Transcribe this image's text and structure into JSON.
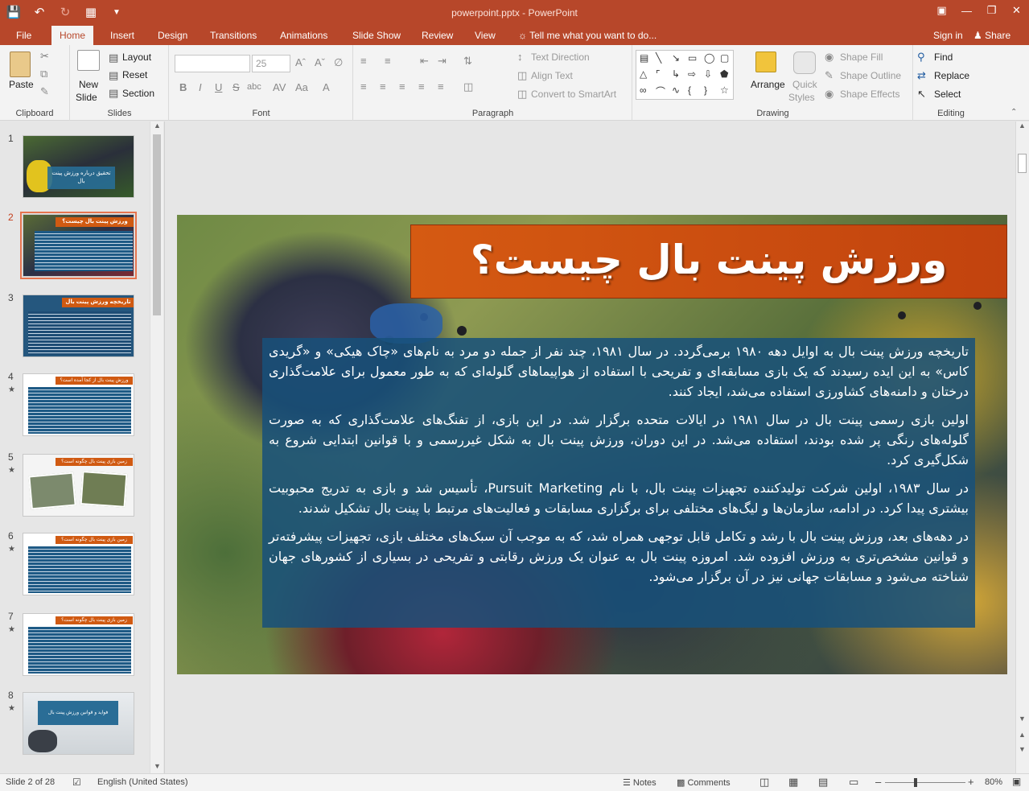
{
  "titlebar": {
    "title": "powerpoint.pptx - PowerPoint",
    "qat_icons": [
      "save-icon",
      "undo-icon",
      "redo-icon",
      "presenter-icon",
      "customize-icon"
    ],
    "window_controls": [
      "ribbon-options-icon",
      "minimize-icon",
      "restore-icon",
      "close-icon"
    ]
  },
  "tabs": [
    "File",
    "Home",
    "Insert",
    "Design",
    "Transitions",
    "Animations",
    "Slide Show",
    "Review",
    "View"
  ],
  "active_tab": "Home",
  "tellme": "Tell me what you want to do...",
  "signin": "Sign in",
  "share": "Share",
  "ribbon": {
    "clipboard": {
      "label": "Clipboard",
      "paste": "Paste"
    },
    "slides": {
      "label": "Slides",
      "new_slide_1": "New",
      "new_slide_2": "Slide",
      "layout": "Layout",
      "reset": "Reset",
      "section": "Section"
    },
    "font": {
      "label": "Font",
      "font_name": "",
      "font_size": "25",
      "bold": "B",
      "italic": "I",
      "underline": "U",
      "strike": "S",
      "shadow": "abc"
    },
    "paragraph": {
      "label": "Paragraph",
      "text_direction": "Text Direction",
      "align_text": "Align Text",
      "smartart": "Convert to SmartArt"
    },
    "drawing": {
      "label": "Drawing",
      "arrange": "Arrange",
      "quick_styles_1": "Quick",
      "quick_styles_2": "Styles",
      "shape_fill": "Shape Fill",
      "shape_outline": "Shape Outline",
      "shape_effects": "Shape Effects"
    },
    "editing": {
      "label": "Editing",
      "find": "Find",
      "replace": "Replace",
      "select": "Select"
    }
  },
  "thumbnails": {
    "numbers": [
      "1",
      "2",
      "3",
      "4",
      "5",
      "6",
      "7",
      "8"
    ],
    "active": 2,
    "slide1_title": "تحقیق درباره ورزش پینت بال",
    "slide2_title": "ورزش پینت بال چیست؟",
    "slide3_title": "تاریخچه ورزش پینت بال",
    "slide4_title": "ورزش پینت بال از کجا آمده است؟",
    "slide5_title": "زمین بازی پینت بال چگونه است؟",
    "slide6_title": "زمین بازی پینت بال چگونه است؟",
    "slide7_title": "زمین بازی پینت بال چگونه است؟",
    "slide8_title": "فواید و قوانین ورزش پینت بال"
  },
  "slide": {
    "title": "ورزش پینت بال چیست؟",
    "paragraphs": [
      "تاریخچه ورزش پینت بال به اوایل دهه ۱۹۸۰ برمی‌گردد. در سال ۱۹۸۱، چند نفر از جمله دو مرد به نام‌های «چاک هیکی» و «گریدی کاس» به این ایده رسیدند که یک بازی مسابقه‌ای و تفریحی با استفاده از هواپیماهای گلوله‌ای که به طور معمول برای علامت‌گذاری درختان و دامنه‌های کشاورزی استفاده می‌شد، ایجاد کنند.",
      "اولین بازی رسمی پینت بال در سال ۱۹۸۱ در ایالات متحده برگزار شد. در این بازی، از تفنگ‌های علامت‌گذاری که به صورت گلوله‌های رنگی پر شده بودند، استفاده می‌شد. در این دوران، ورزش پینت بال به شکل غیررسمی و با قوانین ابتدایی شروع به شکل‌گیری کرد.",
      "در سال ۱۹۸۳، اولین شرکت تولیدکننده تجهیزات پینت بال، با نام Pursuit Marketing، تأسیس شد و بازی به تدریج محبوبیت بیشتری پیدا کرد. در ادامه، سازمان‌ها و لیگ‌های مختلفی برای برگزاری مسابقات و فعالیت‌های مرتبط با پینت بال تشکیل شدند.",
      "در دهه‌های بعد، ورزش پینت بال با رشد و تکامل قابل توجهی همراه شد، که به موجب آن سبک‌های مختلف بازی، تجهیزات پیشرفته‌تر و قوانین مشخص‌تری به ورزش افزوده شد. امروزه پینت بال به عنوان یک ورزش رقابتی و تفریحی در بسیاری از کشورهای جهان شناخته می‌شود و مسابقات جهانی نیز در آن برگزار می‌شود."
    ]
  },
  "status": {
    "slide_info": "Slide 2 of 28",
    "language": "English (United States)",
    "notes": "Notes",
    "comments": "Comments",
    "zoom": "80%",
    "zoom_level": 0.8
  },
  "colors": {
    "accent": "#b7472a",
    "title_fill": "#c9480f",
    "body_fill": "#17507a"
  }
}
